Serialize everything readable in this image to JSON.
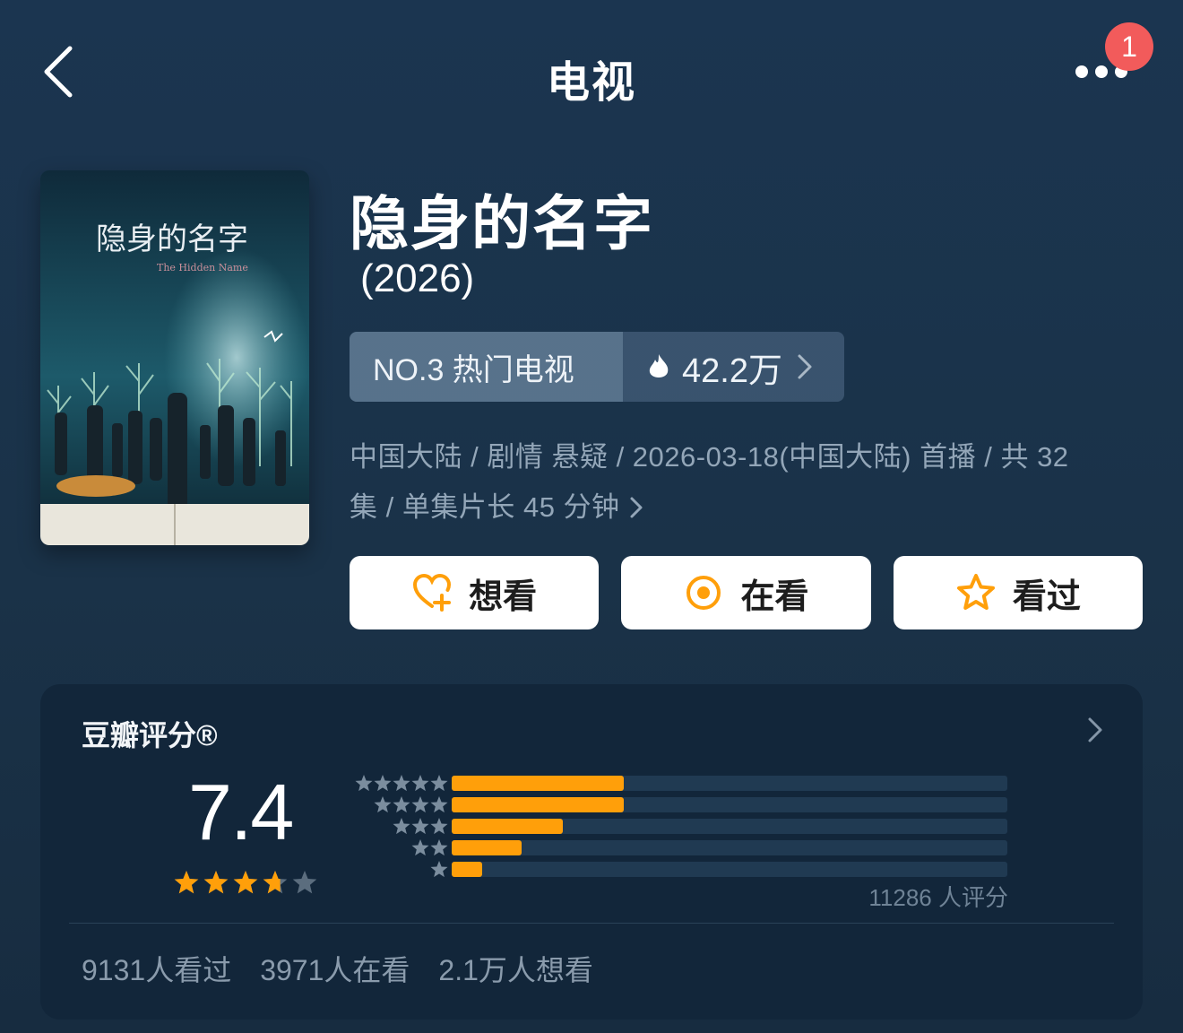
{
  "header": {
    "title": "电视",
    "notification_count": "1"
  },
  "show": {
    "title": "隐身的名字",
    "year": "(2026)",
    "poster_title": "隐身的名字",
    "poster_subtitle": "The Hidden Name",
    "rank_label": "NO.3 热门电视",
    "heat": "42.2万",
    "meta_line1": "中国大陆 / 剧情 悬疑 / 2026-03-18(中国大陆) 首播 / 共 32",
    "meta_line2": "集 / 单集片长 45 分钟"
  },
  "actions": {
    "want": "想看",
    "watching": "在看",
    "watched": "看过"
  },
  "rating": {
    "title": "豆瓣评分®",
    "score": "7.4",
    "score_value": 7.4,
    "votes": "11286 人评分",
    "distribution": [
      {
        "stars": 5,
        "fraction": 0.31
      },
      {
        "stars": 4,
        "fraction": 0.31
      },
      {
        "stars": 3,
        "fraction": 0.2
      },
      {
        "stars": 2,
        "fraction": 0.125
      },
      {
        "stars": 1,
        "fraction": 0.055
      }
    ]
  },
  "stats": {
    "watched": "9131人看过",
    "watching": "3971人在看",
    "want": "2.1万人想看"
  },
  "colors": {
    "accent": "#ff9f0a",
    "badge": "#f25b5b",
    "bg": "#1b3550",
    "card": "#12263a"
  }
}
